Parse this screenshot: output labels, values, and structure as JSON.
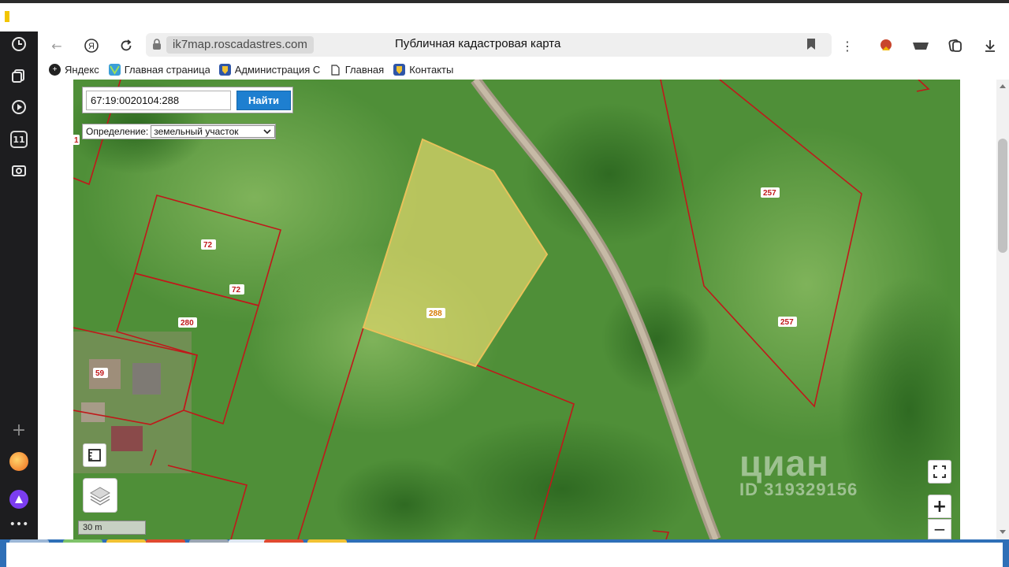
{
  "browser": {
    "url": "ik7map.roscadastres.com",
    "page_title": "Публичная кадастровая карта",
    "sidebar_badge": "11"
  },
  "bookmarks": [
    {
      "label": "Яндекс",
      "icon": "plus-icon"
    },
    {
      "label": "Главная страница",
      "icon": "site-icon"
    },
    {
      "label": "Администрация С",
      "icon": "emblem-icon"
    },
    {
      "label": "Главная",
      "icon": "page-icon"
    },
    {
      "label": "Контакты",
      "icon": "emblem-icon"
    }
  ],
  "search": {
    "value": "67:19:0020104:288",
    "button_label": "Найти"
  },
  "definition": {
    "label": "Определение:",
    "selected": "земельный участок"
  },
  "map": {
    "scale_label": "30 m",
    "zoom_in": "+",
    "zoom_out": "−",
    "parcel_labels": [
      "1",
      "72",
      "72",
      "280",
      "59",
      "288",
      "257",
      "257"
    ],
    "selected_parcel_color": "#d9d46a",
    "boundary_color": "#c0181a"
  },
  "watermark": {
    "brand": "циан",
    "id_text": "ID 319329156"
  }
}
